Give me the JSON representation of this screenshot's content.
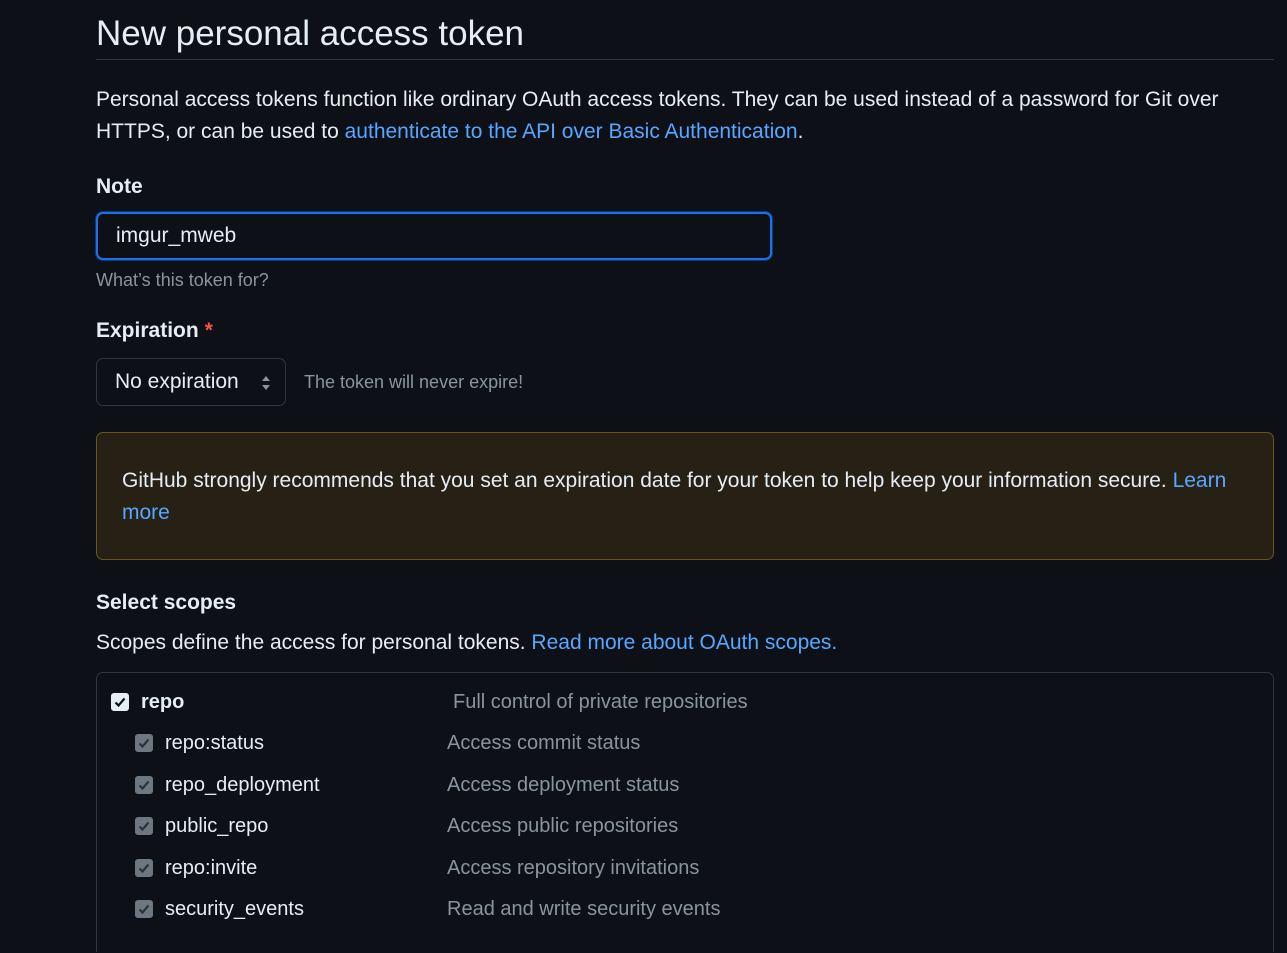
{
  "page": {
    "title": "New personal access token",
    "intro_text": "Personal access tokens function like ordinary OAuth access tokens. They can be used instead of a password for Git over HTTPS, or can be used to ",
    "intro_link": "authenticate to the API over Basic Authentication",
    "intro_end": "."
  },
  "note": {
    "label": "Note",
    "value": "imgur_mweb",
    "hint": "What’s this token for?"
  },
  "expiration": {
    "label": "Expiration",
    "required_mark": "*",
    "selected": "No expiration",
    "note": "The token will never expire!"
  },
  "warning": {
    "text": "GitHub strongly recommends that you set an expiration date for your token to help keep your information secure. ",
    "link": "Learn more"
  },
  "scopes": {
    "title": "Select scopes",
    "description": "Scopes define the access for personal tokens. ",
    "link": "Read more about OAuth scopes.",
    "items": [
      {
        "name": "repo",
        "description": "Full control of private repositories",
        "checked": true
      },
      {
        "name": "repo:status",
        "description": "Access commit status",
        "checked": true
      },
      {
        "name": "repo_deployment",
        "description": "Access deployment status",
        "checked": true
      },
      {
        "name": "public_repo",
        "description": "Access public repositories",
        "checked": true
      },
      {
        "name": "repo:invite",
        "description": "Access repository invitations",
        "checked": true
      },
      {
        "name": "security_events",
        "description": "Read and write security events",
        "checked": true
      }
    ]
  },
  "colors": {
    "background": "#0d1117",
    "link": "#58a6ff",
    "focus": "#1f6feb",
    "warning_bg": "#272115",
    "required": "#f85149"
  }
}
